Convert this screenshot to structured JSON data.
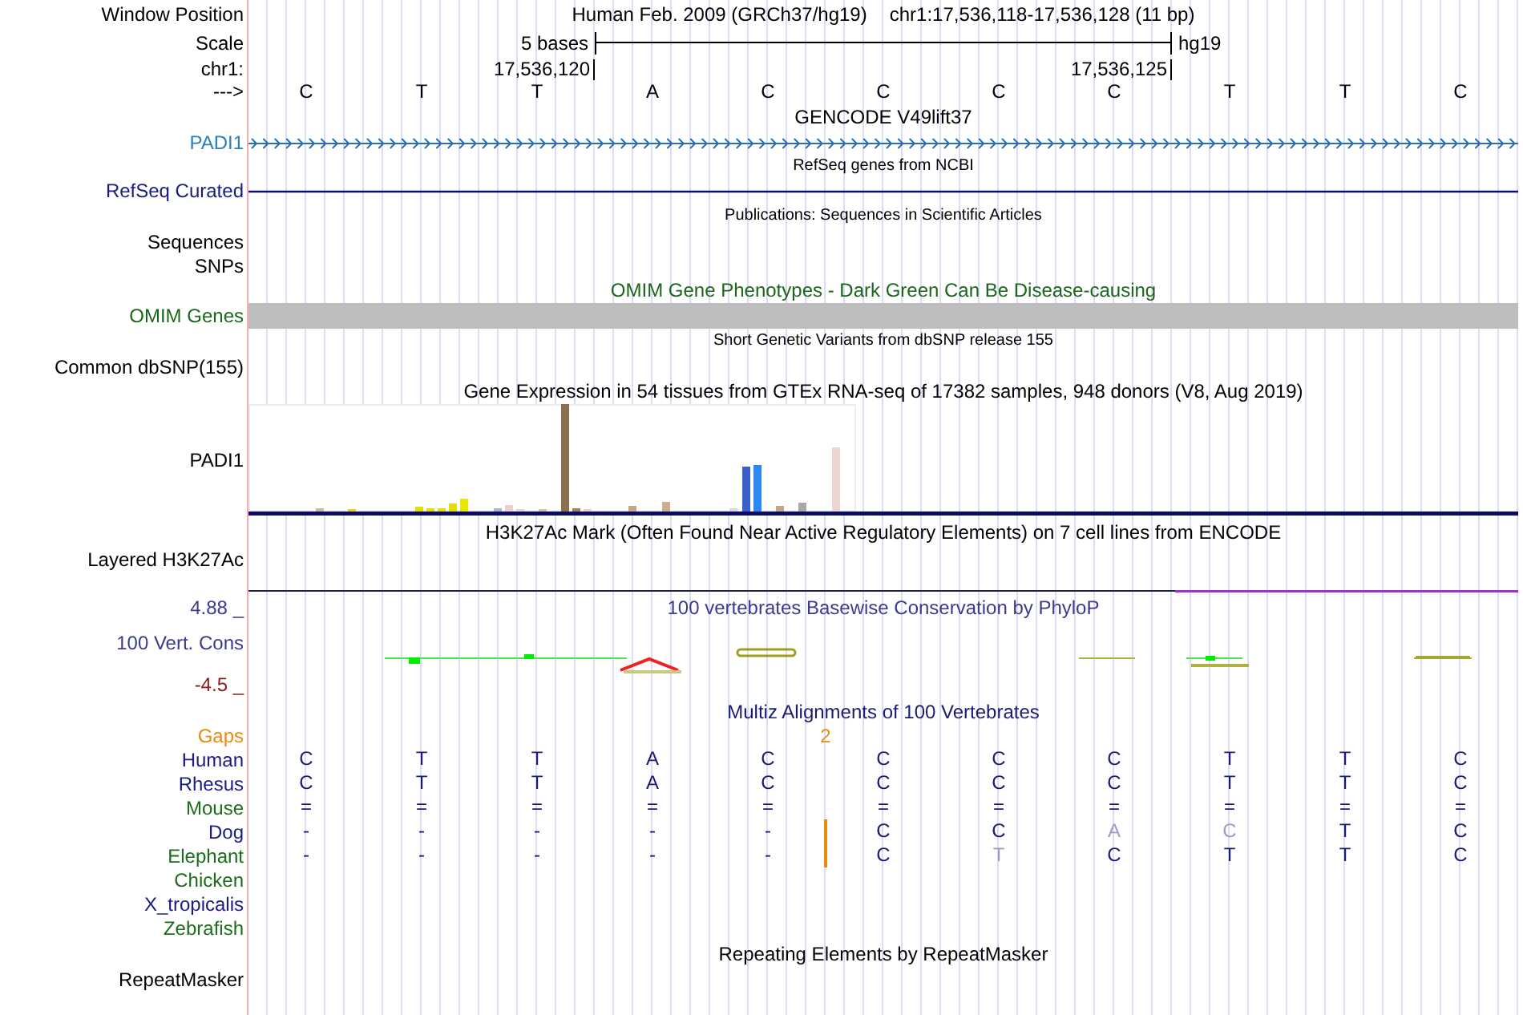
{
  "window_position": {
    "label": "Window Position",
    "assembly": "Human Feb. 2009 (GRCh37/hg19)",
    "position": "chr1:17,536,118-17,536,128 (11 bp)"
  },
  "scale": {
    "label": "Scale",
    "span": "5 bases",
    "assembly": "hg19"
  },
  "coordinates": {
    "label": "chr1:",
    "ticks": [
      "17,536,120",
      "17,536,125"
    ]
  },
  "bases_row": {
    "label": "--->",
    "bases": [
      "C",
      "T",
      "T",
      "A",
      "C",
      "C",
      "C",
      "C",
      "T",
      "T",
      "C"
    ]
  },
  "tracks": [
    {
      "kind": "gene",
      "title": "GENCODE V49lift37",
      "label": "PADI1"
    },
    {
      "kind": "line",
      "title": "RefSeq genes from NCBI",
      "label": "RefSeq Curated"
    },
    {
      "kind": "sparse",
      "title": "Publications: Sequences in Scientific Articles",
      "labels": [
        "Sequences",
        "SNPs"
      ]
    },
    {
      "kind": "bar",
      "title": "OMIM Gene Phenotypes - Dark Green Can Be Disease-causing",
      "label": "OMIM Genes"
    },
    {
      "kind": "sparse",
      "title": "Short Genetic Variants from dbSNP release 155",
      "labels": [
        "Common dbSNP(155)"
      ]
    },
    {
      "kind": "expression",
      "title": "Gene Expression in 54 tissues from GTEx RNA-seq of 17382 samples, 948 donors (V8, Aug 2019)",
      "label": "PADI1"
    },
    {
      "kind": "layered",
      "title": "H3K27Ac Mark (Often Found Near Active Regulatory Elements) on 7 cell lines from ENCODE",
      "label": "Layered H3K27Ac"
    },
    {
      "kind": "wiggle",
      "title": "100 vertebrates Basewise Conservation by PhyloP",
      "label": "100 Vert. Cons",
      "max": "4.88 _",
      "min": "-4.5 _"
    },
    {
      "kind": "multiz",
      "title": "Multiz Alignments of 100 Vertebrates",
      "gaps": {
        "label": "Gaps",
        "count": "2"
      },
      "species": [
        {
          "name": "Human",
          "color": "#1a1a80",
          "bases": [
            {
              "kind": "base",
              "text": "C",
              "dim": false
            },
            {
              "kind": "base",
              "text": "T",
              "dim": false
            },
            {
              "kind": "base",
              "text": "T",
              "dim": false
            },
            {
              "kind": "base",
              "text": "A",
              "dim": false
            },
            {
              "kind": "base",
              "text": "C",
              "dim": false
            },
            {
              "kind": "base",
              "text": "C",
              "dim": false
            },
            {
              "kind": "base",
              "text": "C",
              "dim": false
            },
            {
              "kind": "base",
              "text": "C",
              "dim": false
            },
            {
              "kind": "base",
              "text": "T",
              "dim": false
            },
            {
              "kind": "base",
              "text": "T",
              "dim": false
            },
            {
              "kind": "base",
              "text": "C",
              "dim": false
            }
          ]
        },
        {
          "name": "Rhesus",
          "color": "#1a1a80",
          "bases": [
            {
              "kind": "base",
              "text": "C",
              "dim": false
            },
            {
              "kind": "base",
              "text": "T",
              "dim": false
            },
            {
              "kind": "base",
              "text": "T",
              "dim": false
            },
            {
              "kind": "base",
              "text": "A",
              "dim": false
            },
            {
              "kind": "base",
              "text": "C",
              "dim": false
            },
            {
              "kind": "base",
              "text": "C",
              "dim": false
            },
            {
              "kind": "base",
              "text": "C",
              "dim": false
            },
            {
              "kind": "base",
              "text": "C",
              "dim": false
            },
            {
              "kind": "base",
              "text": "T",
              "dim": false
            },
            {
              "kind": "base",
              "text": "T",
              "dim": false
            },
            {
              "kind": "base",
              "text": "C",
              "dim": false
            }
          ]
        },
        {
          "name": "Mouse",
          "color": "#1a6e1a",
          "bases": [
            {
              "kind": "base",
              "text": "=",
              "dim": false
            },
            {
              "kind": "base",
              "text": "=",
              "dim": false
            },
            {
              "kind": "base",
              "text": "=",
              "dim": false
            },
            {
              "kind": "base",
              "text": "=",
              "dim": false
            },
            {
              "kind": "base",
              "text": "=",
              "dim": false
            },
            {
              "kind": "base",
              "text": "=",
              "dim": false
            },
            {
              "kind": "base",
              "text": "=",
              "dim": false
            },
            {
              "kind": "base",
              "text": "=",
              "dim": false
            },
            {
              "kind": "base",
              "text": "=",
              "dim": false
            },
            {
              "kind": "base",
              "text": "=",
              "dim": false
            },
            {
              "kind": "base",
              "text": "=",
              "dim": false
            }
          ]
        },
        {
          "name": "Dog",
          "color": "#1a1a80",
          "bases": [
            {
              "kind": "base",
              "text": "-",
              "dim": false
            },
            {
              "kind": "base",
              "text": "-",
              "dim": false
            },
            {
              "kind": "base",
              "text": "-",
              "dim": false
            },
            {
              "kind": "base",
              "text": "-",
              "dim": false
            },
            {
              "kind": "base",
              "text": "-",
              "dim": false
            },
            {
              "kind": "insert"
            },
            {
              "kind": "base",
              "text": "C",
              "dim": false
            },
            {
              "kind": "base",
              "text": "C",
              "dim": false
            },
            {
              "kind": "base",
              "text": "A",
              "dim": true
            },
            {
              "kind": "base",
              "text": "C",
              "dim": true
            },
            {
              "kind": "base",
              "text": "T",
              "dim": false
            },
            {
              "kind": "base",
              "text": "C",
              "dim": false
            }
          ]
        },
        {
          "name": "Elephant",
          "color": "#1a6e1a",
          "bases": [
            {
              "kind": "base",
              "text": "-",
              "dim": false
            },
            {
              "kind": "base",
              "text": "-",
              "dim": false
            },
            {
              "kind": "base",
              "text": "-",
              "dim": false
            },
            {
              "kind": "base",
              "text": "-",
              "dim": false
            },
            {
              "kind": "base",
              "text": "-",
              "dim": false
            },
            {
              "kind": "insert"
            },
            {
              "kind": "base",
              "text": "C",
              "dim": false
            },
            {
              "kind": "base",
              "text": "T",
              "dim": true
            },
            {
              "kind": "base",
              "text": "C",
              "dim": false
            },
            {
              "kind": "base",
              "text": "T",
              "dim": false
            },
            {
              "kind": "base",
              "text": "T",
              "dim": false
            },
            {
              "kind": "base",
              "text": "C",
              "dim": false
            }
          ]
        },
        {
          "name": "Chicken",
          "color": "#1a6e1a"
        },
        {
          "name": "X_tropicalis",
          "color": "#1a1a80"
        },
        {
          "name": "Zebrafish",
          "color": "#1a6e1a"
        }
      ]
    },
    {
      "kind": "repeats",
      "title": "Repeating Elements by RepeatMasker",
      "label": "RepeatMasker"
    }
  ]
}
